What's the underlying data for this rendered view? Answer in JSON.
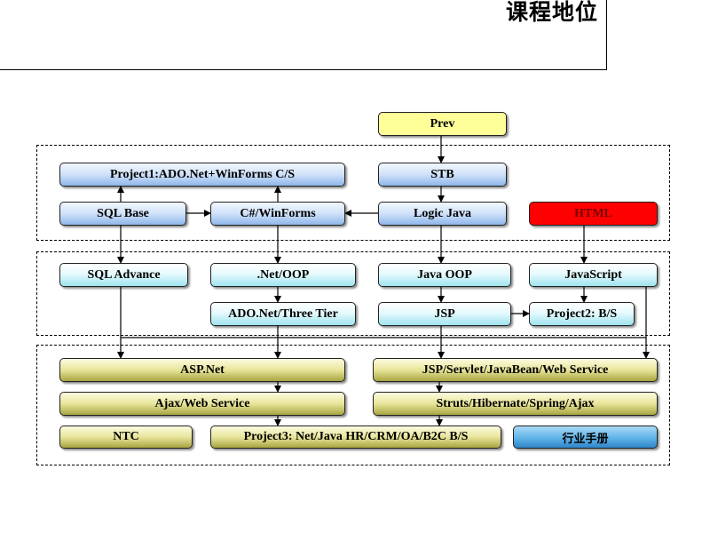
{
  "title": "课程地位",
  "groups": [
    {
      "name": "stage-1"
    },
    {
      "name": "stage-2"
    },
    {
      "name": "stage-3"
    }
  ],
  "nodes": {
    "prev": "Prev",
    "project1": "Project1:ADO.Net+WinForms C/S",
    "stb": "STB",
    "sql_base": "SQL Base",
    "csharp_winforms": "C#/WinForms",
    "logic_java": "Logic Java",
    "html": "HTML",
    "sql_advance": "SQL Advance",
    "net_oop": ".Net/OOP",
    "java_oop": "Java OOP",
    "javascript": "JavaScript",
    "ado_three_tier": "ADO.Net/Three Tier",
    "jsp": "JSP",
    "project2": "Project2:  B/S",
    "asp_net": "ASP.Net",
    "jsp_servlet": "JSP/Servlet/JavaBean/Web Service",
    "ajax_ws": "Ajax/Web Service",
    "struts": "Struts/Hibernate/Spring/Ajax",
    "ntc": "NTC",
    "project3": "Project3:  Net/Java HR/CRM/OA/B2C B/S",
    "industry_manual": "行业手册"
  },
  "edges": [
    {
      "from": "prev",
      "to": "stb"
    },
    {
      "from": "stb",
      "to": "logic_java"
    },
    {
      "from": "logic_java",
      "to": "csharp_winforms"
    },
    {
      "from": "sql_base",
      "to": "csharp_winforms"
    },
    {
      "from": "sql_base",
      "to": "project1"
    },
    {
      "from": "csharp_winforms",
      "to": "project1"
    },
    {
      "from": "sql_base",
      "to": "sql_advance"
    },
    {
      "from": "csharp_winforms",
      "to": "net_oop"
    },
    {
      "from": "logic_java",
      "to": "java_oop"
    },
    {
      "from": "html",
      "to": "javascript"
    },
    {
      "from": "net_oop",
      "to": "ado_three_tier"
    },
    {
      "from": "java_oop",
      "to": "jsp"
    },
    {
      "from": "javascript",
      "to": "project2"
    },
    {
      "from": "jsp",
      "to": "project2"
    },
    {
      "from": "sql_advance",
      "to": "asp_net"
    },
    {
      "from": "ado_three_tier",
      "to": "asp_net"
    },
    {
      "from": "jsp",
      "to": "jsp_servlet"
    },
    {
      "from": "javascript",
      "to": "jsp_servlet"
    },
    {
      "from": "asp_net",
      "to": "ajax_ws"
    },
    {
      "from": "jsp_servlet",
      "to": "struts"
    },
    {
      "from": "ajax_ws",
      "to": "project3"
    },
    {
      "from": "struts",
      "to": "project3"
    }
  ]
}
